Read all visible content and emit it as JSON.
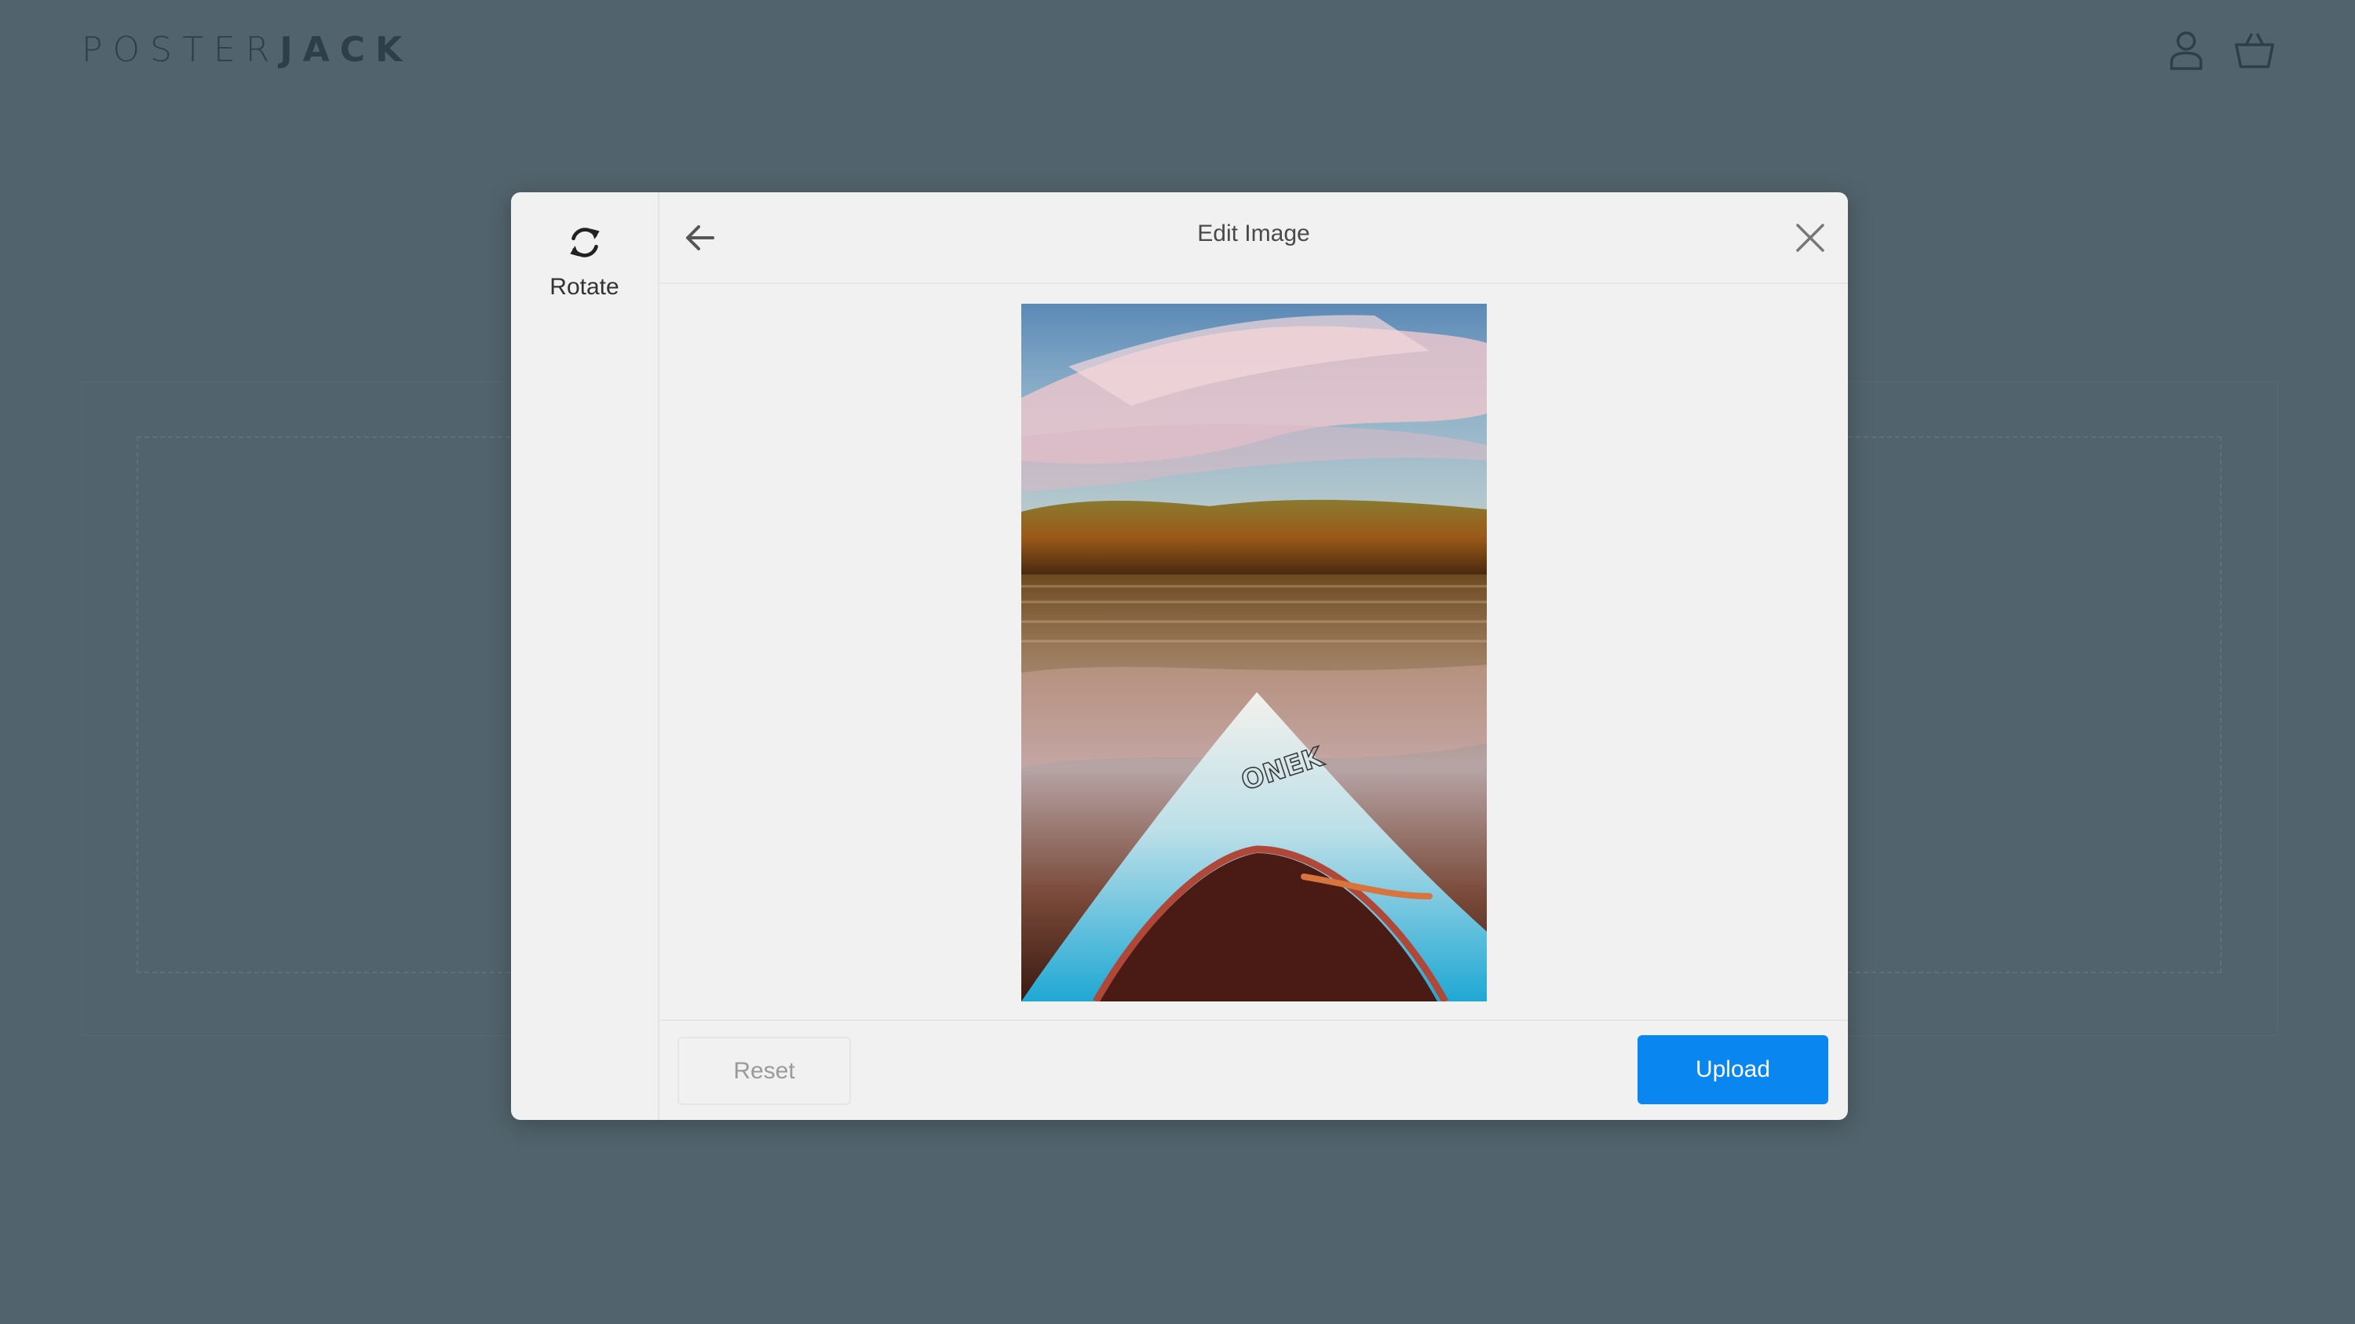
{
  "header": {
    "logo_light": "POSTER",
    "logo_bold": "JACK",
    "account_icon": "account-icon",
    "cart_icon": "cart-icon"
  },
  "modal": {
    "title": "Edit Image",
    "tools": [
      {
        "label": "Rotate",
        "icon": "rotate-icon"
      }
    ],
    "back_icon": "arrow-left-icon",
    "close_icon": "close-icon",
    "reset_label": "Reset",
    "upload_label": "Upload",
    "image_description_icon": "photo-preview"
  },
  "colors": {
    "page_background": "#51636c",
    "modal_background": "#f1f1f1",
    "upload_button": "#0a86f0",
    "logo": "#2f3f47"
  }
}
